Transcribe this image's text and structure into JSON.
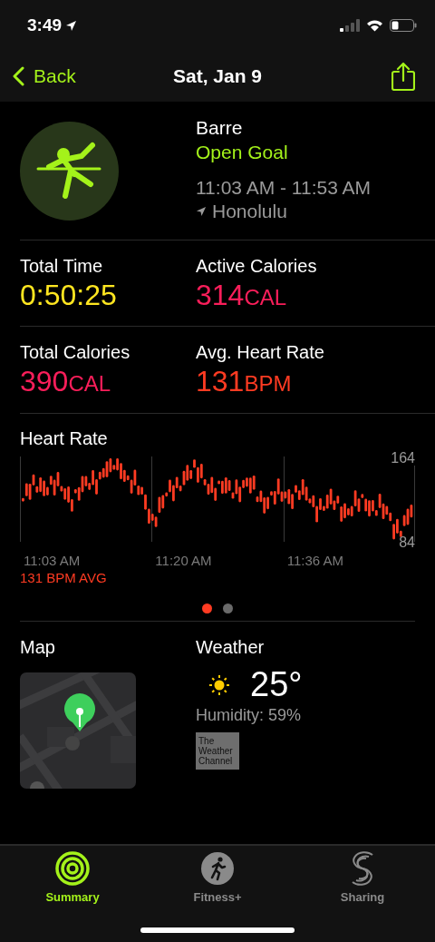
{
  "status_bar": {
    "time": "3:49"
  },
  "nav": {
    "back": "Back",
    "title": "Sat, Jan 9"
  },
  "workout": {
    "name": "Barre",
    "goal": "Open Goal",
    "time_range": "11:03 AM - 11:53 AM",
    "location": "Honolulu"
  },
  "metrics": [
    {
      "label": "Total Time",
      "value": "0:50:25",
      "color": "#ffe620"
    },
    {
      "label": "Active Calories",
      "value": "314",
      "unit": "CAL",
      "color": "#fa1e5a"
    },
    {
      "label": "Total Calories",
      "value": "390",
      "unit": "CAL",
      "color": "#fa1e5a"
    },
    {
      "label": "Avg. Heart Rate",
      "value": "131",
      "unit": "BPM",
      "color": "#ff3b22"
    }
  ],
  "heart_rate": {
    "title": "Heart Rate",
    "y_max": "164",
    "y_min": "84",
    "x_labels": [
      "11:03 AM",
      "11:20 AM",
      "11:36 AM"
    ],
    "average": "131 BPM AVG"
  },
  "pager": [
    {
      "selected": true
    },
    {
      "selected": false
    }
  ],
  "map": {
    "title": "Map"
  },
  "weather": {
    "title": "Weather",
    "temperature": "25°",
    "humidity": "Humidity: 59%",
    "logo_text": "The Weather Channel"
  },
  "tabs": [
    {
      "label": "Summary",
      "selected": true
    },
    {
      "label": "Fitness+",
      "selected": false
    },
    {
      "label": "Sharing",
      "selected": false
    }
  ]
}
